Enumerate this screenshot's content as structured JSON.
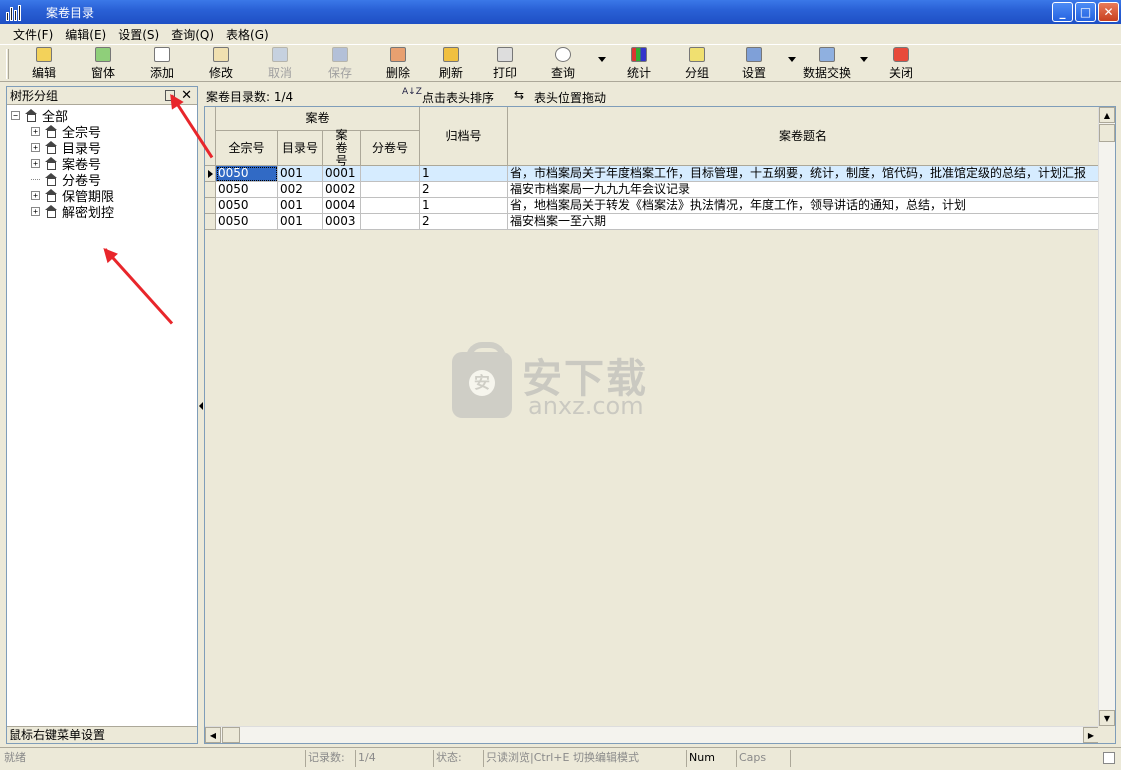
{
  "window": {
    "title": "案卷目录",
    "minimize": "_",
    "maximize": "□",
    "close": "✕"
  },
  "menu": [
    "文件(F)",
    "编辑(E)",
    "设置(S)",
    "查询(Q)",
    "表格(G)"
  ],
  "toolbar": {
    "edit": "编辑",
    "window": "窗体",
    "add": "添加",
    "modify": "修改",
    "cancel": "取消",
    "save": "保存",
    "delete": "删除",
    "refresh": "刷新",
    "print": "打印",
    "query": "查询",
    "stats": "统计",
    "group": "分组",
    "settings": "设置",
    "exchange": "数据交换",
    "close": "关闭"
  },
  "left_panel": {
    "title": "树形分组",
    "close": "✕",
    "tree": [
      {
        "label": "全部",
        "toggle": "−"
      },
      {
        "label": "全宗号",
        "toggle": "+"
      },
      {
        "label": "目录号",
        "toggle": "+"
      },
      {
        "label": "案卷号",
        "toggle": "+"
      },
      {
        "label": "分卷号",
        "toggle": ""
      },
      {
        "label": "保管期限",
        "toggle": "+"
      },
      {
        "label": "解密划控",
        "toggle": "+"
      }
    ],
    "footer": "鼠标右键菜单设置"
  },
  "info": {
    "count": "案卷目录数: 1/4",
    "sort_icon": "A↓Z",
    "sort": "点击表头排序",
    "drag_icon": "⇆",
    "drag": "表头位置拖动"
  },
  "grid": {
    "group_header": "案卷",
    "headers": [
      "全宗号",
      "目录号",
      "案卷号",
      "分卷号",
      "归档号",
      "案卷题名"
    ],
    "rows": [
      [
        "0050",
        "001",
        "0001",
        "",
        "1",
        "省，市档案局关于年度档案工作，目标管理，十五纲要，统计，制度，馆代码，批准馆定级的总结，计划汇报"
      ],
      [
        "0050",
        "002",
        "0002",
        "",
        "2",
        "福安市档案局一九九九年会议记录"
      ],
      [
        "0050",
        "001",
        "0004",
        "",
        "1",
        "省，地档案局关于转发《档案法》执法情况，年度工作，领导讲话的通知，总结，计划"
      ],
      [
        "0050",
        "001",
        "0003",
        "",
        "2",
        "福安档案一至六期"
      ]
    ]
  },
  "watermark": {
    "badge": "安",
    "cn": "安下载",
    "en": "anxz.com"
  },
  "status": {
    "ready": "就绪",
    "records_label": "记录数:",
    "records": "1/4",
    "state_label": "状态:",
    "mode": "只读浏览|Ctrl+E 切换编辑模式",
    "num": "Num",
    "caps": "Caps"
  },
  "colors": {
    "titlebar": "#2a61d6",
    "selection": "#316ac5",
    "arrow": "#e8262b"
  }
}
